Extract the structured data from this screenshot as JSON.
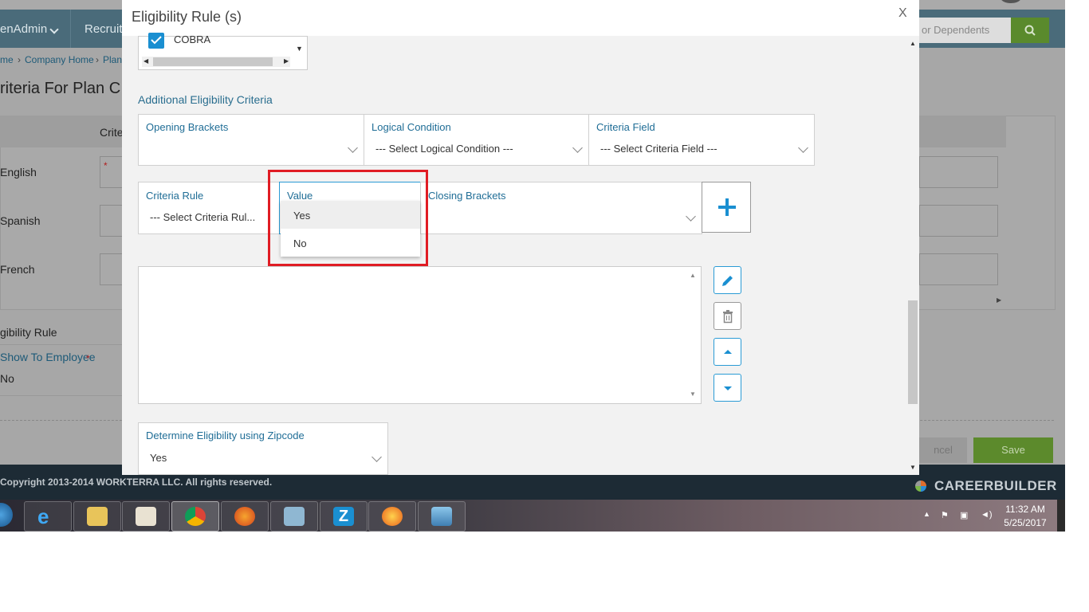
{
  "background": {
    "nav": [
      "enAdmin",
      "Recruit"
    ],
    "search_placeholder": "or Dependents",
    "breadcrumbs": [
      "me",
      "Company Home",
      "Plan"
    ],
    "page_title": "riteria For Plan C",
    "table_header": "Crite",
    "languages": [
      "English",
      "Spanish",
      "French"
    ],
    "required_mark": "*",
    "eligibility_rule_label": "gibility Rule",
    "show_to_employee_label": "Show To Employee",
    "show_to_employee_value": "No",
    "cancel_label": "ncel",
    "save_label": "Save",
    "copyright": "Copyright 2013-2014 WORKTERRA LLC. All rights reserved.",
    "brand": "CAREERBUILDER"
  },
  "modal": {
    "title": "Eligibility Rule (s)",
    "close_label": "X",
    "cobra_label": "COBRA",
    "section_label": "Additional Eligibility Criteria",
    "fields": {
      "opening_brackets": {
        "label": "Opening Brackets",
        "value": ""
      },
      "logical_condition": {
        "label": "Logical Condition",
        "value": "--- Select Logical Condition ---"
      },
      "criteria_field": {
        "label": "Criteria Field",
        "value": "--- Select Criteria Field ---"
      },
      "criteria_rule": {
        "label": "Criteria Rule",
        "value": "--- Select Criteria Rul..."
      },
      "value": {
        "label": "Value",
        "value": ""
      },
      "closing_brackets": {
        "label": "Closing Brackets",
        "value": ""
      },
      "zipcode": {
        "label": "Determine Eligibility using Zipcode",
        "value": "Yes"
      }
    },
    "value_options": [
      "Yes",
      "No"
    ],
    "highlighted_option": "Yes"
  },
  "taskbar": {
    "time": "11:32 AM",
    "date": "5/25/2017",
    "apps": [
      "internet-explorer",
      "file-explorer",
      "media-player",
      "chrome",
      "firefox",
      "notepad",
      "zoom",
      "firefox-dev",
      "photos"
    ]
  }
}
